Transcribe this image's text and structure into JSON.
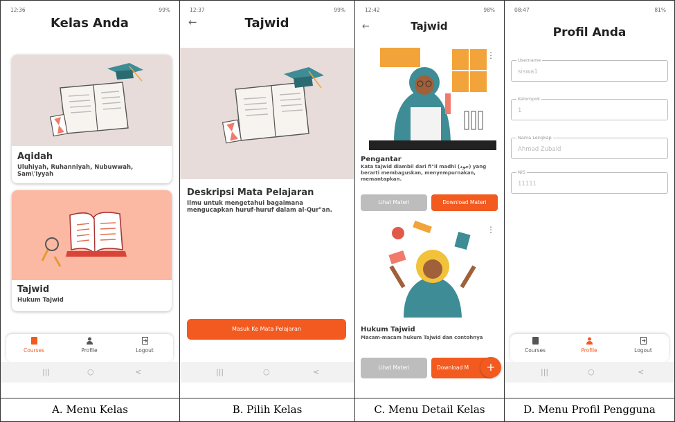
{
  "panels": {
    "a": {
      "status": {
        "time": "12:36",
        "right": "99%"
      },
      "title": "Kelas Anda",
      "courses": [
        {
          "title": "Aqidah",
          "subtitle": "Uluhiyah, Ruhanniyah, Nubuwwah, Sam\\'iyyah"
        },
        {
          "title": "Tajwid",
          "subtitle": "Hukum Tajwid"
        }
      ],
      "nav": {
        "courses": "Courses",
        "profile": "Profile",
        "logout": "Logout"
      },
      "caption": "A. Menu Kelas"
    },
    "b": {
      "status": {
        "time": "12:37",
        "right": "99%"
      },
      "title": "Tajwid",
      "desc_heading": "Deskripsi Mata Pelajaran",
      "desc_text": "Ilmu untuk mengetahui bagaimana mengucapkan huruf-huruf dalam al-Qur\"an.",
      "enter_button": "Masuk Ke Mata Pelajaran",
      "caption": "B. Pilih Kelas"
    },
    "c": {
      "status": {
        "time": "12:42",
        "right": "98%"
      },
      "title": "Tajwid",
      "materials": [
        {
          "title": "Pengantar",
          "desc": "Kata tajwid diambil dari fi\"il madhi (جود) yang berarti membaguskan, menyempurnakan, memantapkan.",
          "view": "Lihat Materi",
          "download": "Download Materi"
        },
        {
          "title": "Hukum Tajwid",
          "desc": "Macam-macam hukum Tajwid dan contohnya",
          "view": "Lihat Materi",
          "download": "Download M"
        }
      ],
      "fab": "+",
      "caption": "C. Menu Detail Kelas"
    },
    "d": {
      "status": {
        "time": "08:47",
        "right": "81%"
      },
      "title": "Profil Anda",
      "fields": [
        {
          "label": "Username",
          "value": "siswa1"
        },
        {
          "label": "Kelompok",
          "value": "1"
        },
        {
          "label": "Nama Lengkap",
          "value": "Ahmad Zubaid"
        },
        {
          "label": "NIS",
          "value": "11111"
        }
      ],
      "nav": {
        "courses": "Courses",
        "profile": "Profile",
        "logout": "Logout"
      },
      "caption": "D. Menu Profil Pengguna"
    }
  },
  "sysnav": {
    "recent": "|||",
    "home": "○",
    "back": "<"
  },
  "colors": {
    "accent": "#f25a1f",
    "card_grey": "#e8dcda",
    "card_peach": "#fbb8a2",
    "teal": "#3e8c95"
  }
}
